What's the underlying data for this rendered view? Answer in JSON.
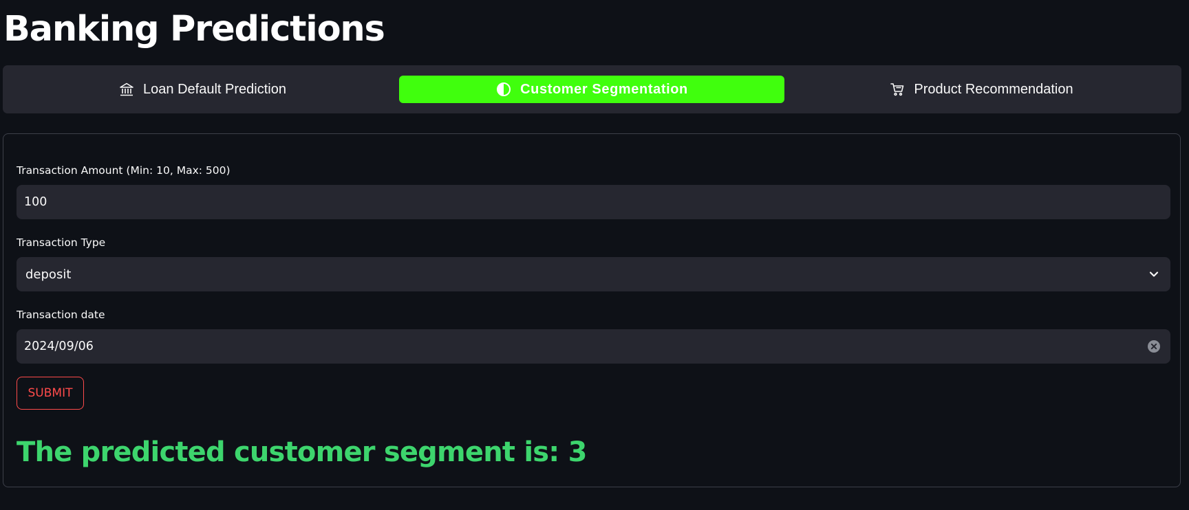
{
  "page": {
    "title": "Banking Predictions"
  },
  "tabs": [
    {
      "label": "Loan Default Prediction",
      "icon": "bank-icon",
      "active": false
    },
    {
      "label": "Customer Segmentation",
      "icon": "contrast-circle-icon",
      "active": true
    },
    {
      "label": "Product Recommendation",
      "icon": "cart-icon",
      "active": false
    }
  ],
  "form": {
    "amount_label": "Transaction Amount (Min: 10, Max: 500)",
    "amount_value": "100",
    "type_label": "Transaction Type",
    "type_value": "deposit",
    "date_label": "Transaction date",
    "date_value": "2024/09/06",
    "submit_label": "SUBMIT"
  },
  "result": {
    "text": "The predicted customer segment is: 3"
  },
  "colors": {
    "background": "#0e1117",
    "surface": "#262730",
    "active_tab": "#40ff0d",
    "submit": "#ff4b4b",
    "result": "#3dd56d"
  }
}
